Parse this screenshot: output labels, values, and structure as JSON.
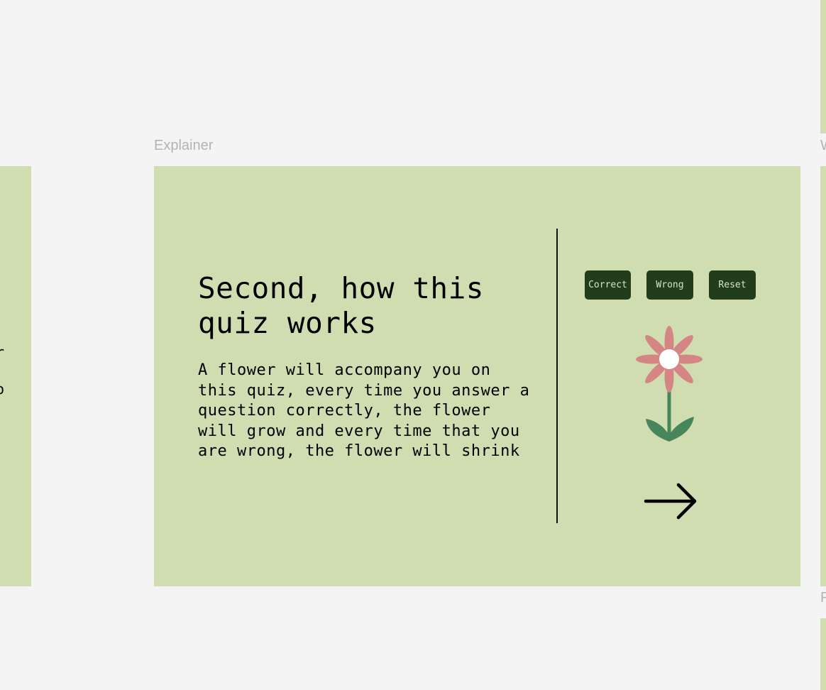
{
  "canvas": {
    "frame_label": "Explainer",
    "right_labels": [
      "W",
      "F"
    ],
    "left_partial_chars": [
      "r",
      "o"
    ]
  },
  "explainer": {
    "heading": "Second, how this quiz works",
    "body": "A flower will accompany you on this quiz, every time you answer a question correctly, the flower will grow and every time that you are wrong, the flower will shrink",
    "buttons": {
      "correct": "Correct",
      "wrong": "Wrong",
      "reset": "Reset"
    }
  },
  "colors": {
    "frame_bg": "#d0ddb0",
    "button_bg": "#213d1c",
    "petal": "#d48584",
    "stem": "#47855a"
  },
  "icons": {
    "flower": "flower-icon",
    "next": "arrow-right-icon"
  }
}
